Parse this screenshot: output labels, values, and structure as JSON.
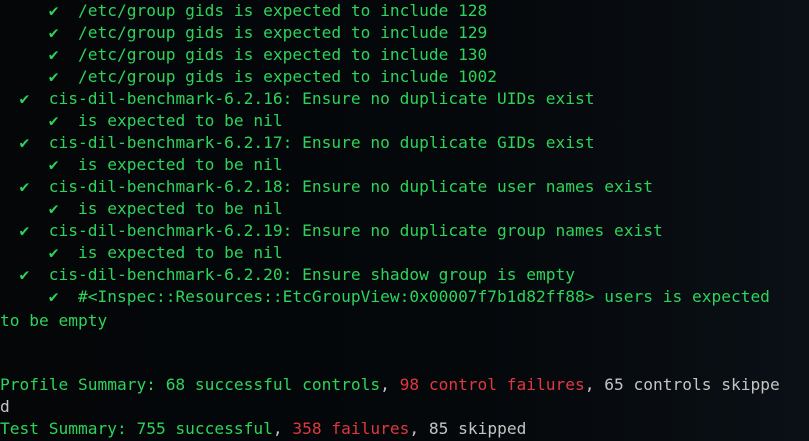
{
  "checkmark": "✔",
  "colors": {
    "pass": "#2ed35a",
    "fail": "#e0383f",
    "skip": "#c4c4c4",
    "background": "#05080b"
  },
  "results": [
    {
      "indent": 2,
      "text": "/etc/group gids is expected to include 128"
    },
    {
      "indent": 2,
      "text": "/etc/group gids is expected to include 129"
    },
    {
      "indent": 2,
      "text": "/etc/group gids is expected to include 130"
    },
    {
      "indent": 2,
      "text": "/etc/group gids is expected to include 1002"
    },
    {
      "indent": 1,
      "text": "cis-dil-benchmark-6.2.16: Ensure no duplicate UIDs exist"
    },
    {
      "indent": 2,
      "text": "is expected to be nil"
    },
    {
      "indent": 1,
      "text": "cis-dil-benchmark-6.2.17: Ensure no duplicate GIDs exist"
    },
    {
      "indent": 2,
      "text": "is expected to be nil"
    },
    {
      "indent": 1,
      "text": "cis-dil-benchmark-6.2.18: Ensure no duplicate user names exist"
    },
    {
      "indent": 2,
      "text": "is expected to be nil"
    },
    {
      "indent": 1,
      "text": "cis-dil-benchmark-6.2.19: Ensure no duplicate group names exist"
    },
    {
      "indent": 2,
      "text": "is expected to be nil"
    },
    {
      "indent": 1,
      "text": "cis-dil-benchmark-6.2.20: Ensure shadow group is empty"
    },
    {
      "indent": 2,
      "text": "#<Inspec::Resources::EtcGroupView:0x00007f7b1d82ff88> users is expected"
    }
  ],
  "wrap_line": "to be empty",
  "profile_summary": {
    "label": "Profile Summary: ",
    "successful": "68 successful controls",
    "sep1": ", ",
    "failures": "98 control failures",
    "sep2": ", ",
    "skipped": "65 controls skippe",
    "skipped_wrap": "d"
  },
  "test_summary": {
    "label": "Test Summary: ",
    "successful": "755 successful",
    "sep1": ", ",
    "failures": "358 failures",
    "sep2": ", ",
    "skipped": "85 skipped"
  }
}
